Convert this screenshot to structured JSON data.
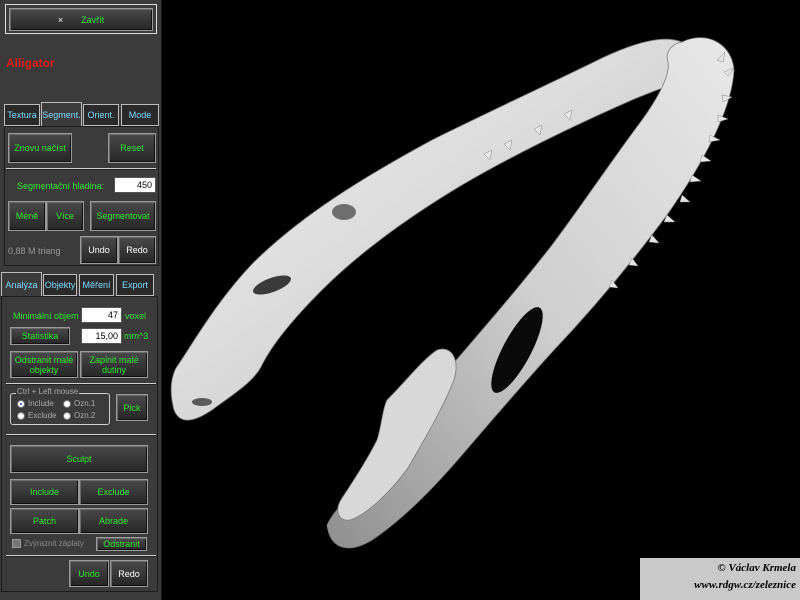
{
  "window": {
    "close_label": "Zavřít",
    "close_icon": "×",
    "title": "Alligator",
    "title_color": "#e21b1b"
  },
  "segment_tabs": [
    "Textura",
    "Segment.",
    "Orient.",
    "Mode"
  ],
  "segment": {
    "reload_label": "Znovu načíst",
    "reset_label": "Reset",
    "level_label": "Segmentační hladina:",
    "level_value": "450",
    "less_label": "Méně",
    "more_label": "Více",
    "segment_label": "Segmentovat",
    "triangles": "0,88 M triang",
    "undo_label": "Undo",
    "redo_label": "Redo"
  },
  "analysis_tabs": [
    "Analýza",
    "Objekty",
    "Měření",
    "Export"
  ],
  "analysis": {
    "min_volume_label": "Minimální objem",
    "min_volume_value": "47",
    "min_volume_unit": "voxel",
    "stats_label": "Statistika",
    "stats_value": "15,00",
    "stats_unit": "mm^3",
    "remove_small_label": "Odstranit malé objekty",
    "fill_small_label": "Zaplnit malé dutiny",
    "mouse_group_label": "Ctrl + Left mouse",
    "radio_include": "Include",
    "radio_exclude": "Exclude",
    "radio_mark1": "Ozn.1",
    "radio_mark2": "Ozn.2",
    "pick_label": "Pick",
    "sculpt_label": "Sculpt",
    "include_label": "Include",
    "exclude_label": "Exclude",
    "patch_label": "Patch",
    "abrade_label": "Abrade",
    "highlight_label": "Zvýraznit záplaty",
    "remove_label": "Odstranit",
    "undo_label": "Undo",
    "redo_label": "Redo"
  },
  "watermark": {
    "line1": "© Václav Krmela",
    "line2": "www.rdgw.cz/zeleznice"
  }
}
